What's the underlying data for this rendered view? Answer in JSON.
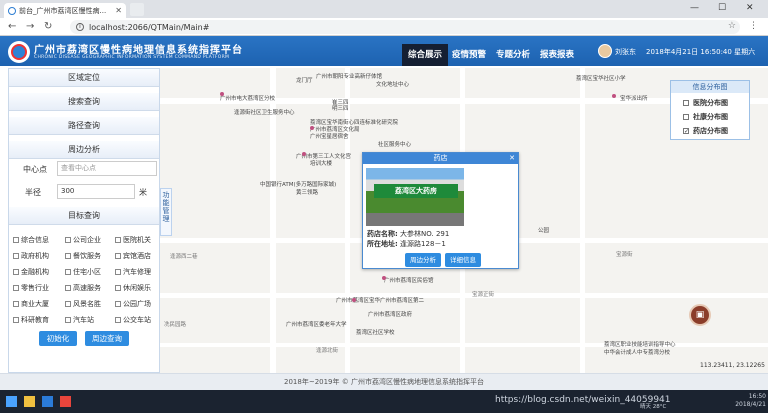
{
  "browser": {
    "tab_title": "前台_广州市荔湾区慢性病...",
    "url": "localhost:2066/QTMain/Main#"
  },
  "app": {
    "title": "广州市荔湾区慢性病地理信息系统指挥平台",
    "subtitle": "CHRONIC DISEASE GEOGRAPHIC INFORMATION SYSTEM COMMAND PLATFORM",
    "tabs": [
      "综合展示",
      "疫情预警",
      "专题分析",
      "报表报表"
    ],
    "user": "刘张东",
    "datetime": "2018年4月21日 16:50:40 星期六"
  },
  "sidebar": {
    "sections": [
      "区域定位",
      "搜索查询",
      "路径查询",
      "周边分析"
    ],
    "center_label": "中心点",
    "center_placeholder": "查看中心点",
    "radius_label": "半径",
    "radius_value": "300",
    "radius_unit": "米",
    "target_title": "目标查询",
    "categories": [
      "综合信息",
      "公司企业",
      "医院机关",
      "政府机构",
      "餐饮服务",
      "宾馆酒店",
      "金融机构",
      "住宅小区",
      "汽车修理",
      "零售行业",
      "高速服务",
      "休闲娱乐",
      "商业大厦",
      "风景名胜",
      "公园广场",
      "科研教育",
      "汽车站",
      "公交车站"
    ],
    "init_btn": "初始化",
    "search_btn": "周边查询"
  },
  "map": {
    "labels": [
      "广州市朝阳专业高新仔体馆",
      "龙门厅",
      "文化地址中心",
      "广州市电大荔湾区分校",
      "逢源街社区卫生服务中心",
      "崔三四",
      "明三四",
      "荔湾区宝华南街心四连标准化研究院",
      "广州市荔湾区文化局",
      "广州宝星居宿舍",
      "社区服务中心",
      "广州市第三工人文化宫",
      "培训大楼",
      "中国银行ATM(多万路国际家城)",
      "黄三领路",
      "逢源西二巷",
      "广州市荔湾区民俗馆",
      "宝源正街",
      "广州市荔湾区宝华广州市荔湾区第二",
      "广州市荔湾区委老年大学",
      "荔湾区社区学校",
      "广州市荔湾区政府",
      "冼民园路",
      "逢源北街",
      "宝源街",
      "荔湾区职业技能培训指导中心",
      "中华会计成人中专荔湾分校",
      "荔湾区宝华社区小学",
      "宝华派出所",
      "公园"
    ],
    "popup": {
      "title": "药店",
      "sign": "荔湾区大药房",
      "name_label": "药店名称:",
      "name_value": "大参林NO. 291",
      "addr_label": "所在地址:",
      "addr_value": "逢源路128－1",
      "btn_around": "周边分析",
      "btn_detail": "详细信息"
    },
    "layer_panel": {
      "title": "信息分布图",
      "items": [
        {
          "label": "医院分布图",
          "checked": false
        },
        {
          "label": "社康分布图",
          "checked": false
        },
        {
          "label": "药店分布图",
          "checked": true
        }
      ]
    },
    "dock_label": "功能管理",
    "coords": "113.23411, 23.12265"
  },
  "footer": "2018年~2019年 © 广州市荔湾区慢性病地理信息系统指挥平台",
  "taskbar": {
    "watermark": "https://blog.csdn.net/weixin_44059941",
    "time": "16:50",
    "date": "2018/4/21",
    "temp": "晴天 28°C"
  },
  "colors": {
    "header": "#1d62b0",
    "active_tab": "#151f33",
    "button": "#2e8ce0"
  }
}
